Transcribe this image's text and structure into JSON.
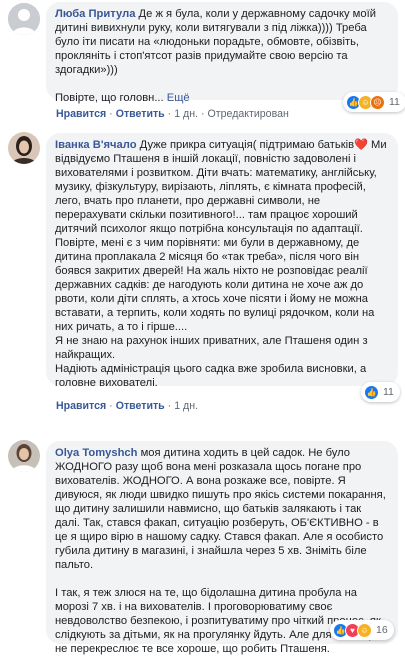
{
  "comments": [
    {
      "author": "Люба Притула",
      "text": "Де ж я була, коли у державному садочку моїй дитині вивихнули руку, коли витягували з під ліжка)))) Треба було іти писати на «людоньки порадьте, обмовте, обізвіть, прокляніть і стоп'ятсот разів придумайте свою версію та здогадки»)))\n\nПовірте, що головн...",
      "more": "Ещё",
      "like_label": "Нравится",
      "reply_label": "Ответить",
      "age": "1 дн.",
      "edited": "Отредактирован",
      "reaction_count": "11",
      "reaction_icons": [
        "like-icon",
        "haha-icon",
        "angry-icon"
      ]
    },
    {
      "author": "Іванка В'ячало",
      "text": "Дуже прикра ситуація( підтримаю батьків❤️ Ми відвідуємо Пташеня в іншій локації, повністю задоволені і вихователями і розвитком. Діти вчать: математику, англійську, музику, фізкультуру, вирізають, ліплять, є кімната професій, лего, вчать про планети, про державні символи, не перерахувати скільки позитивного!... там працює хороший дитячий психолог якщо потрібна консультація по адаптації.\nПовірте, мені є з чим порівняти: ми були в державному, де дитина проплакала 2 місяця бо «так треба», після чого він боявся закритих дверей! На жаль ніхто не розповідає реалії державних садків: де нагодують коли дитина не хоче аж до рвоти, коли діти сплять, а хтось хоче пісяти і йому не можна вставати, а терпить, коли ходять по вулиці рядочком, коли на них ричать, а то і гірше....\nЯ не знаю на рахунок інших приватних, але Пташеня один з найкращих.\nНадіють адміністрація цього садка вже зробила висновки, а головне вихователі.",
      "like_label": "Нравится",
      "reply_label": "Ответить",
      "age": "1 дн.",
      "reaction_count": "11",
      "reaction_icons": [
        "like-icon"
      ]
    },
    {
      "author": "Olya Tomyshch",
      "text": "моя дитина ходить в цей садок. Не було ЖОДНОГО разу щоб вона мені розказала щось погане про вихователів. ЖОДНОГО. А вона розкаже все, повірте. Я дивуюся, як люди швидко пишуть про якісь системи покарання, що дитину залишили навмисно, що батьків залякають і так далі. Так, стався факап, ситуацію розберуть, ОБ'ЄКТИВНО - в це я щиро вірю в нашому садку. Стався факап. Але я особисто губила дитину в магазині, і знайшла через 5 хв. Зніміть біле пальто.\n\nІ так, я теж злюся на те, що бідолашна дитина пробула на морозі 7 хв. і на вихователів. І проговорюватиму своє невдоволство безпекою, і розпитуватиму про чіткий процес, як слідкують за дітьми, як на прогулянку йдуть. Але для мене це не перекреслює те все хороше, що робить Пташеня.",
      "reaction_count": "16",
      "reaction_icons": [
        "like-icon",
        "love-icon",
        "haha-icon"
      ]
    }
  ],
  "colors": {
    "link": "#385898",
    "bubble": "#f2f3f5",
    "meta": "#606770"
  }
}
